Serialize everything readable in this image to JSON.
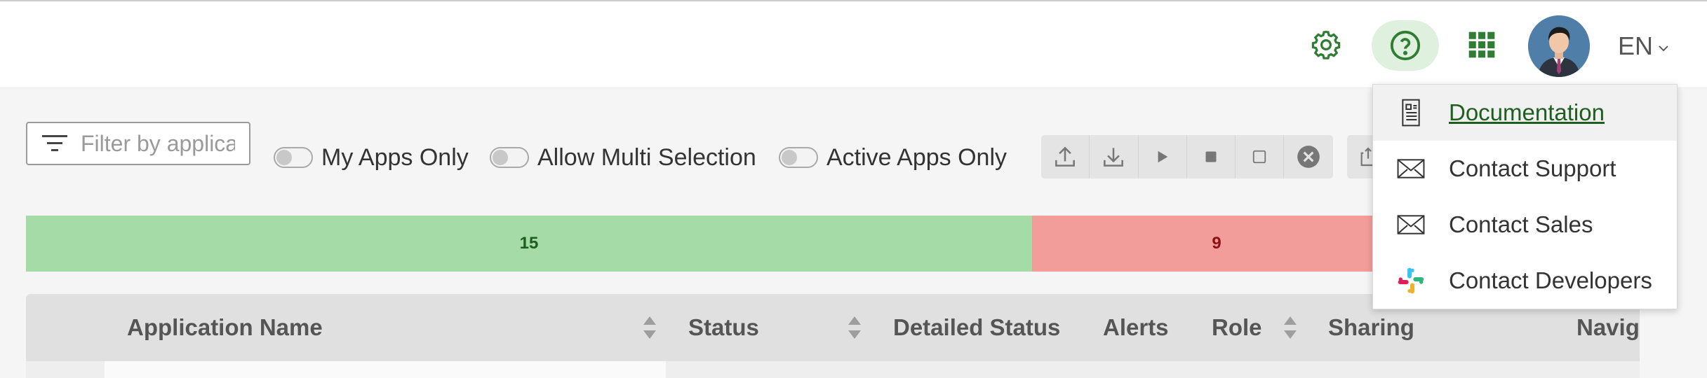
{
  "header": {
    "language": "EN",
    "icons": [
      "settings-gear-icon",
      "help-question-icon",
      "apps-grid-icon",
      "user-avatar"
    ],
    "accent_color": "#2e7d32"
  },
  "toolbar": {
    "filter_placeholder": "Filter by applica",
    "toggles": [
      {
        "label": "My Apps Only",
        "on": false
      },
      {
        "label": "Allow Multi Selection",
        "on": false
      },
      {
        "label": "Active Apps Only",
        "on": false
      }
    ],
    "actions": [
      "upload-icon",
      "download-icon",
      "play-icon",
      "stop-icon",
      "square-icon",
      "close-circle-icon"
    ]
  },
  "status_bar": {
    "segments": [
      {
        "value": "15",
        "color": "#a5dba6"
      },
      {
        "value": "9",
        "color": "#f39d9a"
      }
    ]
  },
  "table": {
    "columns": [
      {
        "label": "Application Name",
        "sortable": true
      },
      {
        "label": "Status",
        "sortable": true
      },
      {
        "label": "Detailed Status",
        "sortable": false
      },
      {
        "label": "Alerts",
        "sortable": false
      },
      {
        "label": "Role",
        "sortable": true
      },
      {
        "label": "Sharing",
        "sortable": false
      },
      {
        "label": "Navig",
        "sortable": false
      }
    ]
  },
  "help_menu": {
    "items": [
      {
        "label": "Documentation",
        "icon": "document-icon"
      },
      {
        "label": "Contact Support",
        "icon": "envelope-icon"
      },
      {
        "label": "Contact Sales",
        "icon": "envelope-icon"
      },
      {
        "label": "Contact Developers",
        "icon": "slack-icon"
      }
    ]
  }
}
